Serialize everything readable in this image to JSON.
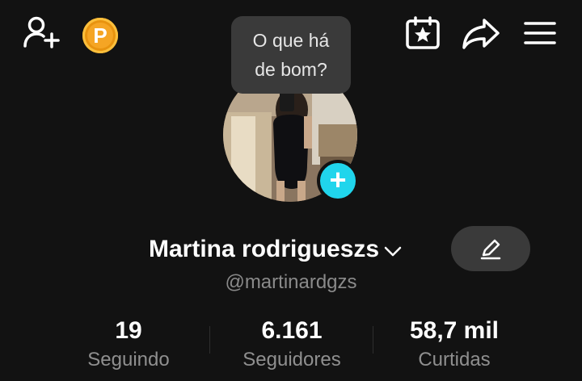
{
  "topbar": {
    "add_user_icon": "add-friend-icon",
    "coin_letter": "P",
    "calendar_icon": "calendar-star-icon",
    "share_icon": "share-arrow-icon",
    "menu_icon": "hamburger-menu-icon"
  },
  "note_bubble": {
    "text": "O que há\nde bom?"
  },
  "profile": {
    "avatar_icon": "profile-photo",
    "add_story_icon": "plus-icon",
    "plus_glyph": "+",
    "name": "Martina rodrigueszs",
    "handle": "@martinardgzs",
    "edit_icon": "pencil-icon"
  },
  "stats": [
    {
      "value": "19",
      "label": "Seguindo"
    },
    {
      "value": "6.161",
      "label": "Seguidores"
    },
    {
      "value": "58,7 mil",
      "label": "Curtidas"
    }
  ],
  "colors": {
    "background": "#121212",
    "accent_cyan": "#20d5ec",
    "coin_orange": "#f5a524",
    "bubble_gray": "#3a3a3a",
    "secondary_text": "#8f8f8f"
  }
}
